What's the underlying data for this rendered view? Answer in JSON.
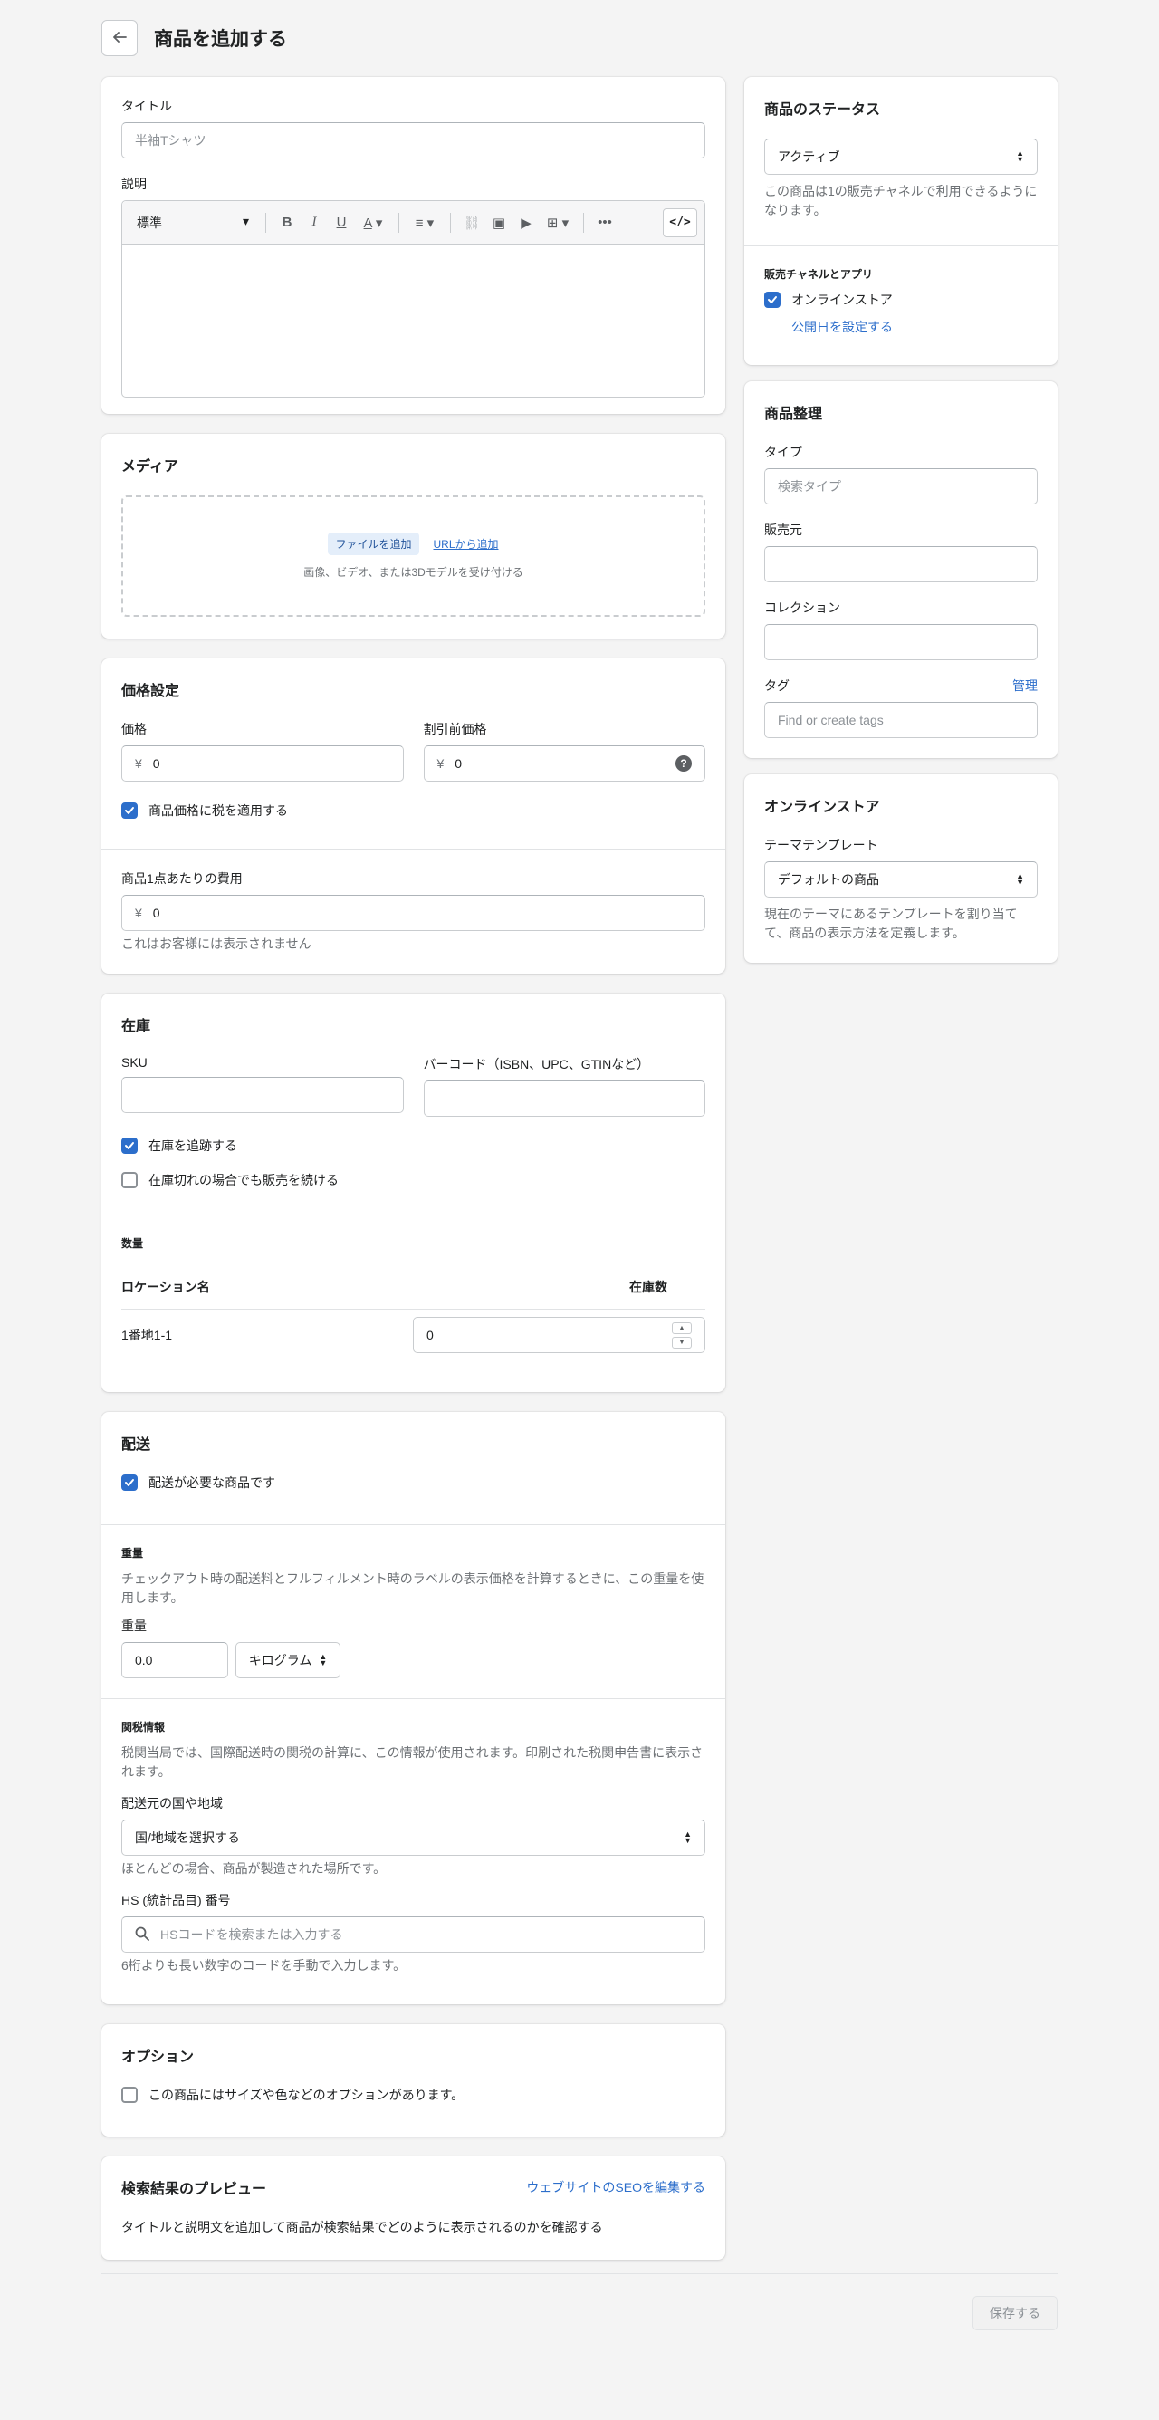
{
  "header": {
    "title": "商品を追加する"
  },
  "details": {
    "title_label": "タイトル",
    "title_placeholder": "半袖Tシャツ",
    "description_label": "説明",
    "editor_style": "標準"
  },
  "media": {
    "title": "メディア",
    "add_file": "ファイルを追加",
    "add_url": "URLから追加",
    "hint": "画像、ビデオ、または3Dモデルを受け付ける"
  },
  "pricing": {
    "title": "価格設定",
    "price_label": "価格",
    "compare_label": "割引前価格",
    "currency": "¥",
    "price_value": "0",
    "compare_value": "0",
    "tax_label": "商品価格に税を適用する",
    "cost_label": "商品1点あたりの費用",
    "cost_value": "0",
    "cost_help": "これはお客様には表示されません"
  },
  "inventory": {
    "title": "在庫",
    "sku_label": "SKU",
    "barcode_label": "バーコード（ISBN、UPC、GTINなど）",
    "track_label": "在庫を追跡する",
    "continue_label": "在庫切れの場合でも販売を続ける",
    "qty_title": "数量",
    "location_header": "ロケーション名",
    "stock_header": "在庫数",
    "location_name": "1番地1-1",
    "stock_value": "0"
  },
  "shipping": {
    "title": "配送",
    "physical_label": "配送が必要な商品です",
    "weight_title": "重量",
    "weight_desc": "チェックアウト時の配送料とフルフィルメント時のラベルの表示価格を計算するときに、この重量を使用します。",
    "weight_label": "重量",
    "weight_value": "0.0",
    "weight_unit": "キログラム",
    "customs_title": "関税情報",
    "customs_desc": "税関当局では、国際配送時の関税の計算に、この情報が使用されます。印刷された税関申告書に表示されます。",
    "country_label": "配送元の国や地域",
    "country_value": "国/地域を選択する",
    "country_help": "ほとんどの場合、商品が製造された場所です。",
    "hs_label": "HS (統計品目) 番号",
    "hs_placeholder": "HSコードを検索または入力する",
    "hs_help": "6桁よりも長い数字のコードを手動で入力します。"
  },
  "options": {
    "title": "オプション",
    "has_options_label": "この商品にはサイズや色などのオプションがあります。"
  },
  "seo": {
    "title": "検索結果のプレビュー",
    "edit_link": "ウェブサイトのSEOを編集する",
    "desc": "タイトルと説明文を追加して商品が検索結果でどのように表示されるのかを確認する"
  },
  "status": {
    "title": "商品のステータス",
    "value": "アクティブ",
    "help": "この商品は1の販売チャネルで利用できるようになります。",
    "channels_title": "販売チャネルとアプリ",
    "online_store": "オンラインストア",
    "schedule_link": "公開日を設定する"
  },
  "organization": {
    "title": "商品整理",
    "type_label": "タイプ",
    "type_placeholder": "検索タイプ",
    "vendor_label": "販売元",
    "collection_label": "コレクション",
    "tags_label": "タグ",
    "manage_link": "管理",
    "tags_placeholder": "Find or create tags"
  },
  "online_store": {
    "title": "オンラインストア",
    "template_label": "テーマテンプレート",
    "template_value": "デフォルトの商品",
    "template_help": "現在のテーマにあるテンプレートを割り当てて、商品の表示方法を定義します。"
  },
  "footer": {
    "save": "保存する"
  },
  "colors": {
    "accent": "#2c6ecb",
    "background": "#f4f4f4"
  }
}
